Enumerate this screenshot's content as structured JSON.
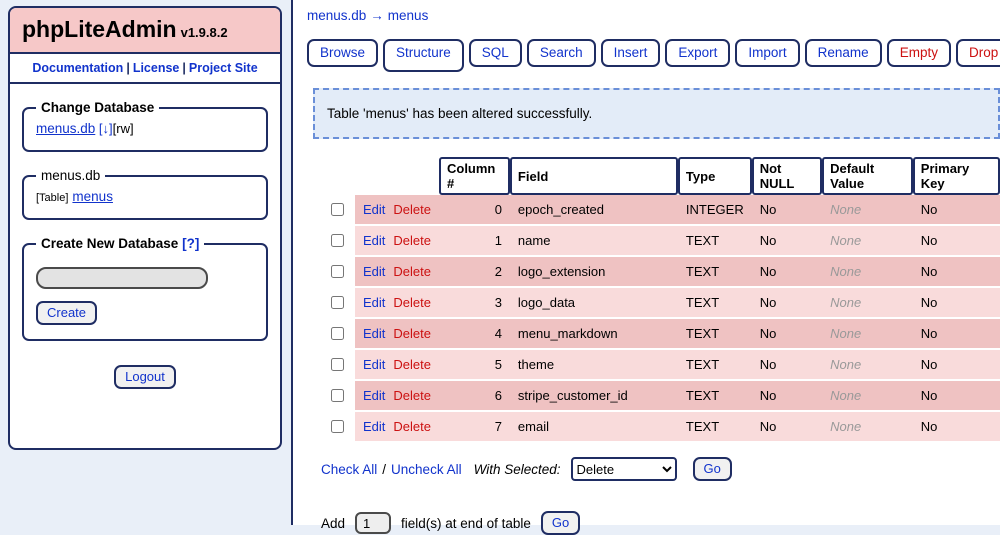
{
  "sidebar": {
    "title": "phpLiteAdmin",
    "version": "v1.9.8.2",
    "nav": {
      "items": [
        "Documentation",
        "License",
        "Project Site"
      ],
      "separator": "|"
    },
    "change_database": {
      "legend": "Change Database",
      "db_link": "menus.db",
      "download_link": "[↓]",
      "rw_flag": "[rw]"
    },
    "database_tree": {
      "legend": "menus.db",
      "table_prefix": "[Table]",
      "table_link": "menus"
    },
    "create_database": {
      "legend": "Create New Database",
      "help_link": "[?]",
      "input_value": "",
      "create_button": "Create"
    },
    "logout_button": "Logout"
  },
  "main": {
    "breadcrumb": {
      "database": "menus.db",
      "arrow": "→",
      "table": "menus"
    },
    "tabs": [
      {
        "label": "Browse",
        "active": false,
        "danger": false
      },
      {
        "label": "Structure",
        "active": true,
        "danger": false
      },
      {
        "label": "SQL",
        "active": false,
        "danger": false
      },
      {
        "label": "Search",
        "active": false,
        "danger": false
      },
      {
        "label": "Insert",
        "active": false,
        "danger": false
      },
      {
        "label": "Export",
        "active": false,
        "danger": false
      },
      {
        "label": "Import",
        "active": false,
        "danger": false
      },
      {
        "label": "Rename",
        "active": false,
        "danger": false
      },
      {
        "label": "Empty",
        "active": false,
        "danger": true
      },
      {
        "label": "Drop",
        "active": false,
        "danger": true
      }
    ],
    "message": "Table 'menus' has been altered successfully.",
    "table": {
      "headers": [
        "Column #",
        "Field",
        "Type",
        "Not NULL",
        "Default Value",
        "Primary Key"
      ],
      "row_actions": {
        "edit": "Edit",
        "delete": "Delete"
      },
      "rows": [
        {
          "column": "0",
          "field": "epoch_created",
          "type": "INTEGER",
          "not_null": "No",
          "default": "None",
          "primary_key": "No"
        },
        {
          "column": "1",
          "field": "name",
          "type": "TEXT",
          "not_null": "No",
          "default": "None",
          "primary_key": "No"
        },
        {
          "column": "2",
          "field": "logo_extension",
          "type": "TEXT",
          "not_null": "No",
          "default": "None",
          "primary_key": "No"
        },
        {
          "column": "3",
          "field": "logo_data",
          "type": "TEXT",
          "not_null": "No",
          "default": "None",
          "primary_key": "No"
        },
        {
          "column": "4",
          "field": "menu_markdown",
          "type": "TEXT",
          "not_null": "No",
          "default": "None",
          "primary_key": "No"
        },
        {
          "column": "5",
          "field": "theme",
          "type": "TEXT",
          "not_null": "No",
          "default": "None",
          "primary_key": "No"
        },
        {
          "column": "6",
          "field": "stripe_customer_id",
          "type": "TEXT",
          "not_null": "No",
          "default": "None",
          "primary_key": "No"
        },
        {
          "column": "7",
          "field": "email",
          "type": "TEXT",
          "not_null": "No",
          "default": "None",
          "primary_key": "No"
        }
      ]
    },
    "selection": {
      "check_all": "Check All",
      "separator": "/",
      "uncheck_all": "Uncheck All",
      "with_selected": "With Selected:",
      "action_selected": "Delete",
      "go_button": "Go"
    },
    "add_field": {
      "prefix": "Add",
      "count": "1",
      "suffix": "field(s) at end of table",
      "go_button": "Go"
    }
  },
  "colors": {
    "accent_navy": "#1f2d63",
    "link_blue": "#1133cc",
    "danger_red": "#cc1111",
    "title_pink": "#f6c8c8",
    "row_dark": "#efc2c2",
    "row_light": "#f9dbdb",
    "message_bg": "#e3ecf8",
    "page_bg": "#e9eff8"
  }
}
